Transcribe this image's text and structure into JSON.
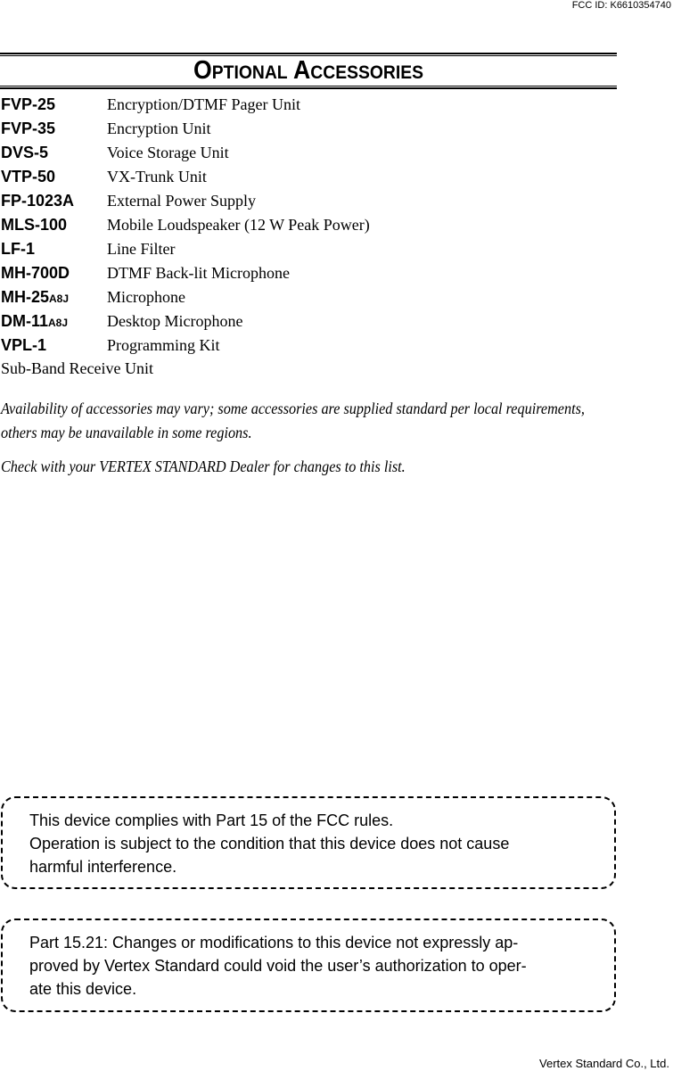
{
  "header": {
    "fcc_id": "FCC ID: K6610354740"
  },
  "title": {
    "word1_initial": "O",
    "word1_rest": "PTIONAL",
    "word2_initial": "A",
    "word2_rest": "CCESSORIES"
  },
  "accessories": [
    {
      "model": "FVP-25",
      "suffix": "",
      "description": "Encryption/DTMF Pager Unit"
    },
    {
      "model": "FVP-35",
      "suffix": "",
      "description": "Encryption Unit"
    },
    {
      "model": "DVS-5",
      "suffix": "",
      "description": "Voice Storage Unit"
    },
    {
      "model": "VTP-50",
      "suffix": "",
      "description": "VX-Trunk Unit"
    },
    {
      "model": "FP-1023A",
      "suffix": "",
      "description": "External Power Supply"
    },
    {
      "model": "MLS-100",
      "suffix": "",
      "description": "Mobile Loudspeaker (12 W Peak Power)"
    },
    {
      "model": "LF-1",
      "suffix": "",
      "description": "Line Filter"
    },
    {
      "model": "MH-700D",
      "suffix": "",
      "description": "DTMF Back-lit Microphone"
    },
    {
      "model": "MH-25",
      "suffix": "A8J",
      "description": "Microphone"
    },
    {
      "model": "DM-11",
      "suffix": "A8J",
      "description": "Desktop Microphone"
    },
    {
      "model": "VPL-1",
      "suffix": "",
      "description": "Programming Kit"
    }
  ],
  "sub_band": "Sub-Band Receive Unit",
  "notes": {
    "availability": "Availability of accessories may vary; some accessories are supplied standard per local requirements, others may be unavailable in some regions.",
    "dealer": "Check with your VERTEX STANDARD Dealer for changes to this list."
  },
  "fcc_box": {
    "line1": "This device complies with Part 15 of the FCC rules.",
    "line2": "Operation is subject to the condition that this device does not cause",
    "line3": "harmful interference."
  },
  "part_box": {
    "line1": "Part 15.21:  Changes or modifications to this device not expressly ap-",
    "line2": "proved by Vertex Standard could void the user’s authorization to oper-",
    "line3": "ate this device."
  },
  "footer": {
    "company": "Vertex Standard Co., Ltd."
  }
}
